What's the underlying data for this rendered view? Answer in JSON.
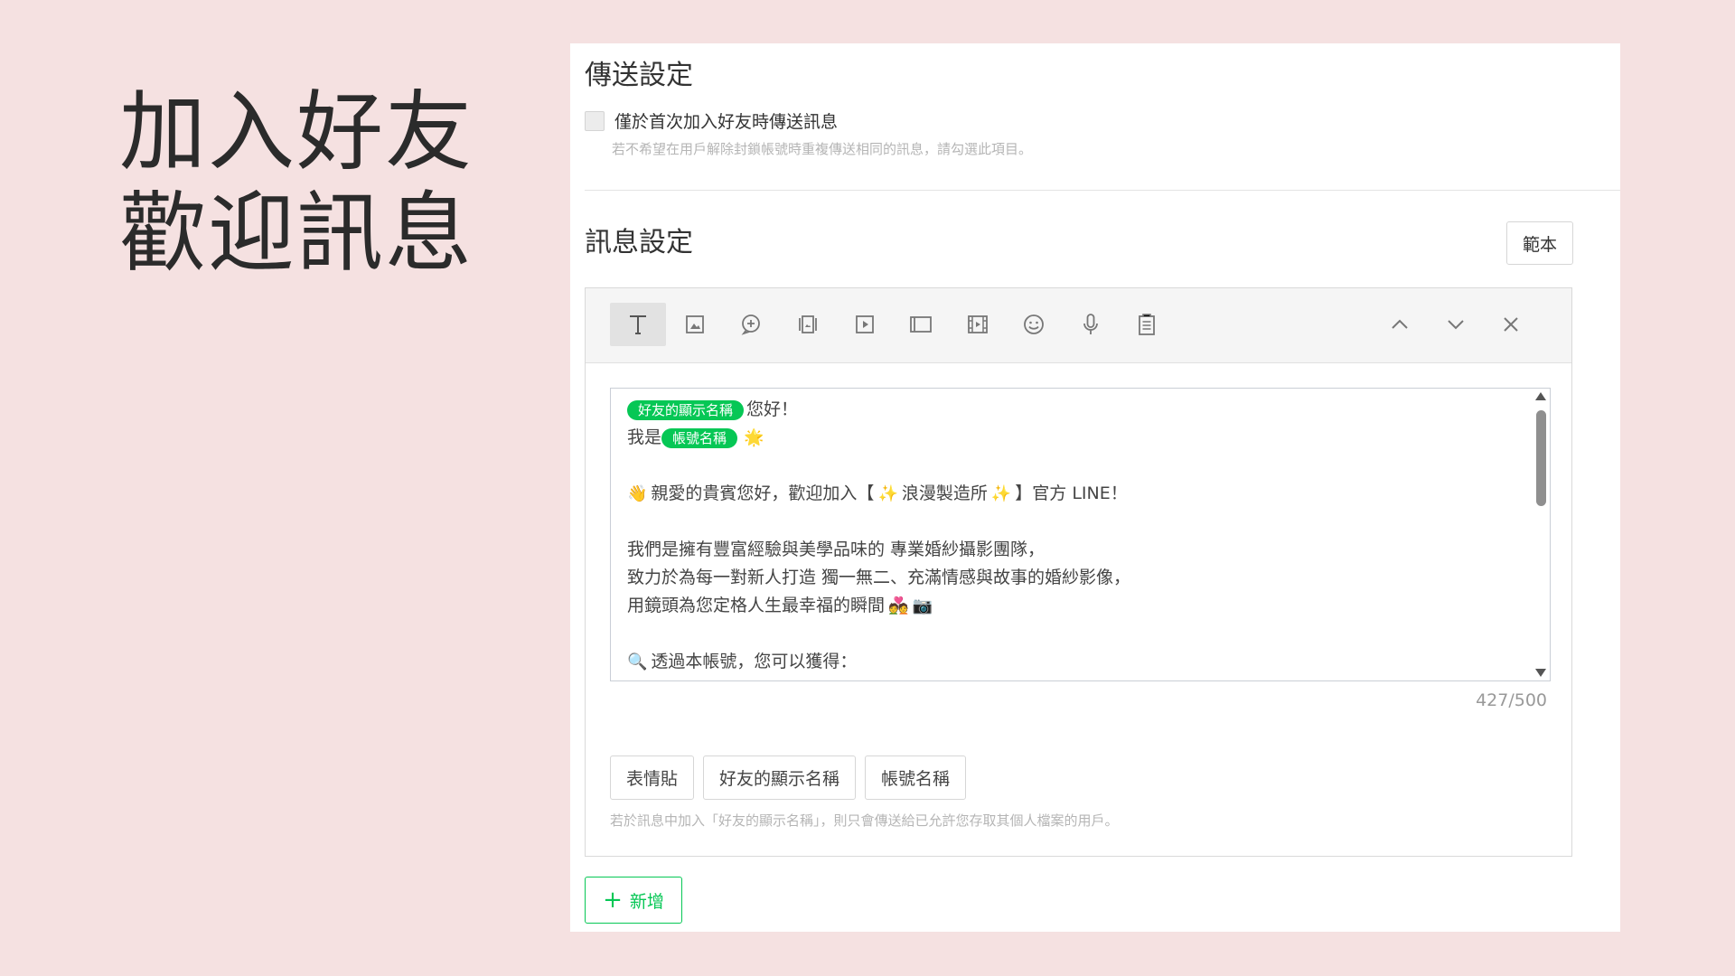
{
  "slide": {
    "title_line1": "加入好友",
    "title_line2": "歡迎訊息"
  },
  "delivery": {
    "title": "傳送設定",
    "checkbox_label": "僅於首次加入好友時傳送訊息",
    "checkbox_checked": false,
    "hint": "若不希望在用戶解除封鎖帳號時重複傳送相同的訊息，請勾選此項目。"
  },
  "message": {
    "title": "訊息設定",
    "template_button": "範本",
    "toolbar_icons": [
      "text-icon",
      "image-icon",
      "add-bubble-icon",
      "card-icon",
      "video-icon",
      "rich-message-icon",
      "rich-video-icon",
      "emoji-icon",
      "voice-icon",
      "coupon-icon"
    ],
    "toolbar_nav_icons": [
      "chevron-up-icon",
      "chevron-down-icon",
      "close-icon"
    ],
    "tag_friend_name": "好友的顯示名稱",
    "tag_account_name": "帳號名稱",
    "line1_text": "您好！",
    "line2_prefix": "我是",
    "line4_text": "親愛的貴賓您好，歡迎加入【",
    "line4_brand": "浪漫製造所",
    "line4_suffix": "】官方 LINE！",
    "line6_text": "我們是擁有豐富經驗與美學品味的 專業婚紗攝影團隊，",
    "line7_text": "致力於為每一對新人打造 獨一無二、充滿情感與故事的婚紗影像，",
    "line8_text": "用鏡頭為您定格人生最幸福的瞬間",
    "line10_text": "透過本帳號，您可以獲得：",
    "counter": "427/500",
    "insert_buttons": [
      "表情貼",
      "好友的顯示名稱",
      "帳號名稱"
    ],
    "insert_hint": "若於訊息中加入「好友的顯示名稱」，則只會傳送給已允許您存取其個人檔案的用戶。",
    "add_button": "新增"
  },
  "colors": {
    "background": "#f5e1e1",
    "accent_green": "#06c755"
  }
}
